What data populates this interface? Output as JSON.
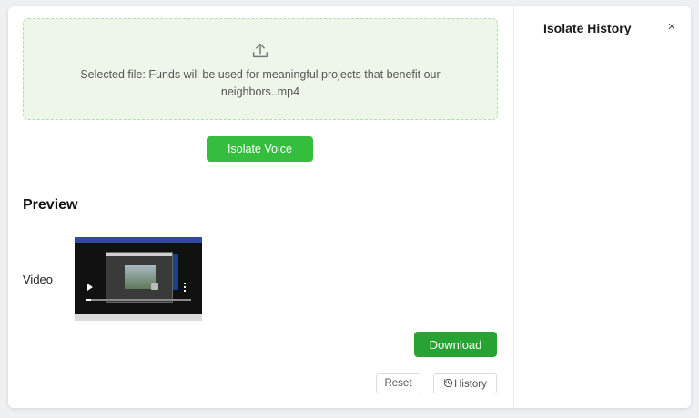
{
  "upload": {
    "icon": "upload-icon",
    "selected_text": "Selected file: Funds will be used for meaningful projects that benefit our neighbors..mp4"
  },
  "actions": {
    "isolate_label": "Isolate Voice",
    "download_label": "Download",
    "reset_label": "Reset",
    "history_label": "History"
  },
  "preview": {
    "title": "Preview",
    "video_label": "Video",
    "playback_progress": 0.05
  },
  "sidebar": {
    "title": "Isolate History",
    "close_glyph": "×"
  },
  "colors": {
    "accent": "#27a233",
    "isolate_button": "#35bd3e",
    "upload_bg": "#eef6ea"
  }
}
